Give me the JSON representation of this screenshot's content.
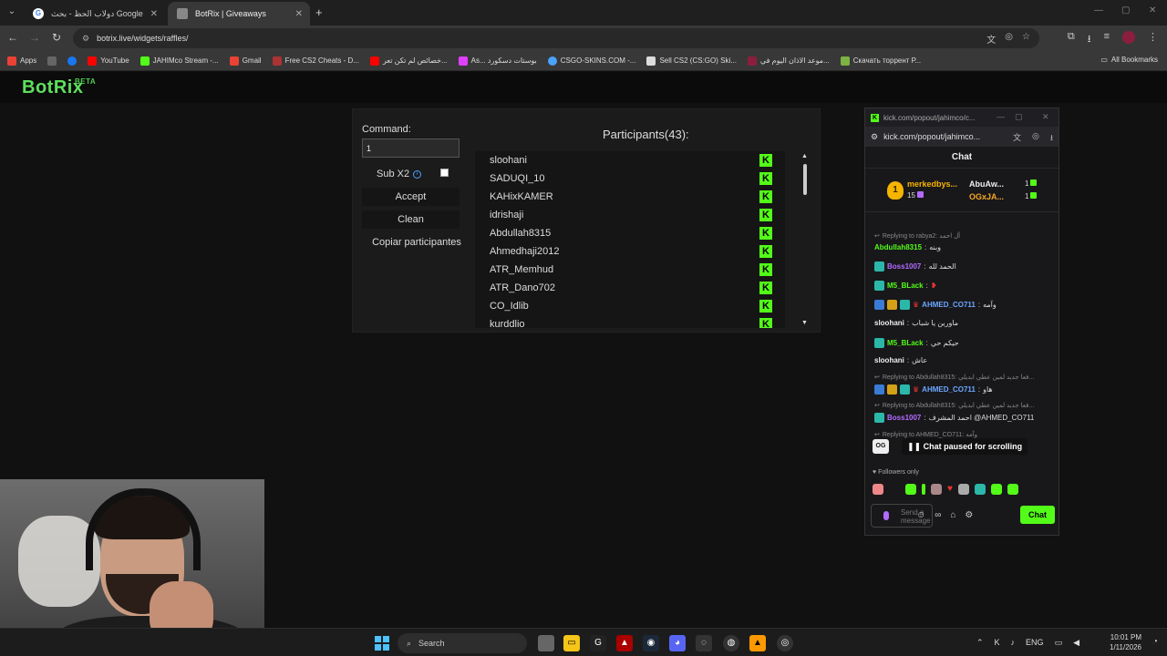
{
  "browser": {
    "tabs": [
      {
        "title": "دولاب الحظ - بحث Google",
        "active": false
      },
      {
        "title": "BotRix | Giveaways",
        "active": true
      }
    ],
    "url": "botrix.live/widgets/raffles/",
    "bookmarks": [
      {
        "label": "Apps",
        "icon": "grid-icon"
      },
      {
        "label": "",
        "icon": "apps-grid-icon"
      },
      {
        "label": "",
        "icon": "facebook-icon",
        "color": "#1877f2"
      },
      {
        "label": "YouTube",
        "icon": "youtube-icon",
        "color": "#ff0000"
      },
      {
        "label": "JAHIMco Stream -...",
        "icon": "kick-icon",
        "color": "#53fc18"
      },
      {
        "label": "Gmail",
        "icon": "gmail-icon",
        "color": "#ea4335"
      },
      {
        "label": "Free CS2 Cheats - D...",
        "icon": "skull-icon",
        "color": "#a33"
      },
      {
        "label": "خصائص لم تكن تعر...",
        "icon": "youtube-icon",
        "color": "#ff0000"
      },
      {
        "label": "As... بوستات دسكورد",
        "icon": "diamond-icon",
        "color": "#e040fb"
      },
      {
        "label": "CSGO-SKINS.COM -...",
        "icon": "globe-icon",
        "color": "#4aa3ff"
      },
      {
        "label": "Sell CS2 (CS:GO) Ski...",
        "icon": "doc-icon",
        "color": "#ddd"
      },
      {
        "label": "موعد الاذان اليوم في...",
        "icon": "mosque-icon",
        "color": "#8b1e3f"
      },
      {
        "label": "Скачать торрент Р...",
        "icon": "torrent-icon",
        "color": "#7cb342"
      }
    ],
    "all_bookmarks": "All Bookmarks"
  },
  "brand": {
    "name": "BotRix",
    "tag": "BETA"
  },
  "raffle": {
    "command_label": "Command:",
    "command_value": "1",
    "sub_label": "Sub X2",
    "accept": "Accept",
    "clean": "Clean",
    "copy": "Copiar participantes",
    "participants_title": "Participants(43):",
    "participants": [
      "sloohani",
      "SADUQI_10",
      "KAHixKAMER",
      "idrishaji",
      "Abdullah8315",
      "Ahmedhaji2012",
      "ATR_Memhud",
      "ATR_Dano702",
      "CO_Idlib",
      "kurddlio"
    ]
  },
  "kick": {
    "window_title": "kick.com/popout/jahimco/c...",
    "url": "kick.com/popout/jahimco...",
    "chat_header": "Chat",
    "leaderboard": {
      "first": {
        "rank": "1",
        "name": "merkedbys...",
        "count": "15"
      },
      "second": {
        "name": "AbuAw...",
        "count": "1"
      },
      "third": {
        "name": "OGxJA...",
        "count": "1"
      }
    },
    "messages": [
      {
        "kind": "reply",
        "text": "Replying to rabya2: أل احمد"
      },
      {
        "user": "Abdullah8315",
        "color": "green",
        "text": "وبنه"
      },
      {
        "user": "Boss1007",
        "color": "purple",
        "text": "الحمد لله"
      },
      {
        "user": "M5_BLack",
        "color": "green",
        "text": ""
      },
      {
        "user": "AHMED_CO711",
        "color": "blue",
        "text": "وآمه"
      },
      {
        "user": "sloohani",
        "color": "white",
        "text": "ماورين يا شباب"
      },
      {
        "user": "M5_BLack",
        "color": "green",
        "text": "حيكم حي"
      },
      {
        "user": "sloohani",
        "color": "white",
        "text": "عاش"
      },
      {
        "kind": "reply",
        "text": "Replying to Abdullah8315: فعا جديد لمين عطي ابديلي..."
      },
      {
        "user": "AHMED_CO711",
        "color": "blue",
        "text": "هاو"
      },
      {
        "kind": "reply",
        "text": "Replying to Abdullah8315: فعا جديد لمين عطي ابديلي..."
      },
      {
        "user": "Boss1007",
        "color": "purple",
        "text": "احمد المشرف @AHMED_CO711"
      },
      {
        "kind": "reply",
        "text": "Replying to AHMED_CO711: وآمه"
      }
    ],
    "og": "OG",
    "paused": "Chat paused for scrolling",
    "followers_only": "Followers only",
    "input_placeholder": "Send a message",
    "send": "Chat"
  },
  "taskbar": {
    "search": "Search",
    "lang": "ENG",
    "time": "10:01 PM",
    "date": "1/11/2026"
  }
}
